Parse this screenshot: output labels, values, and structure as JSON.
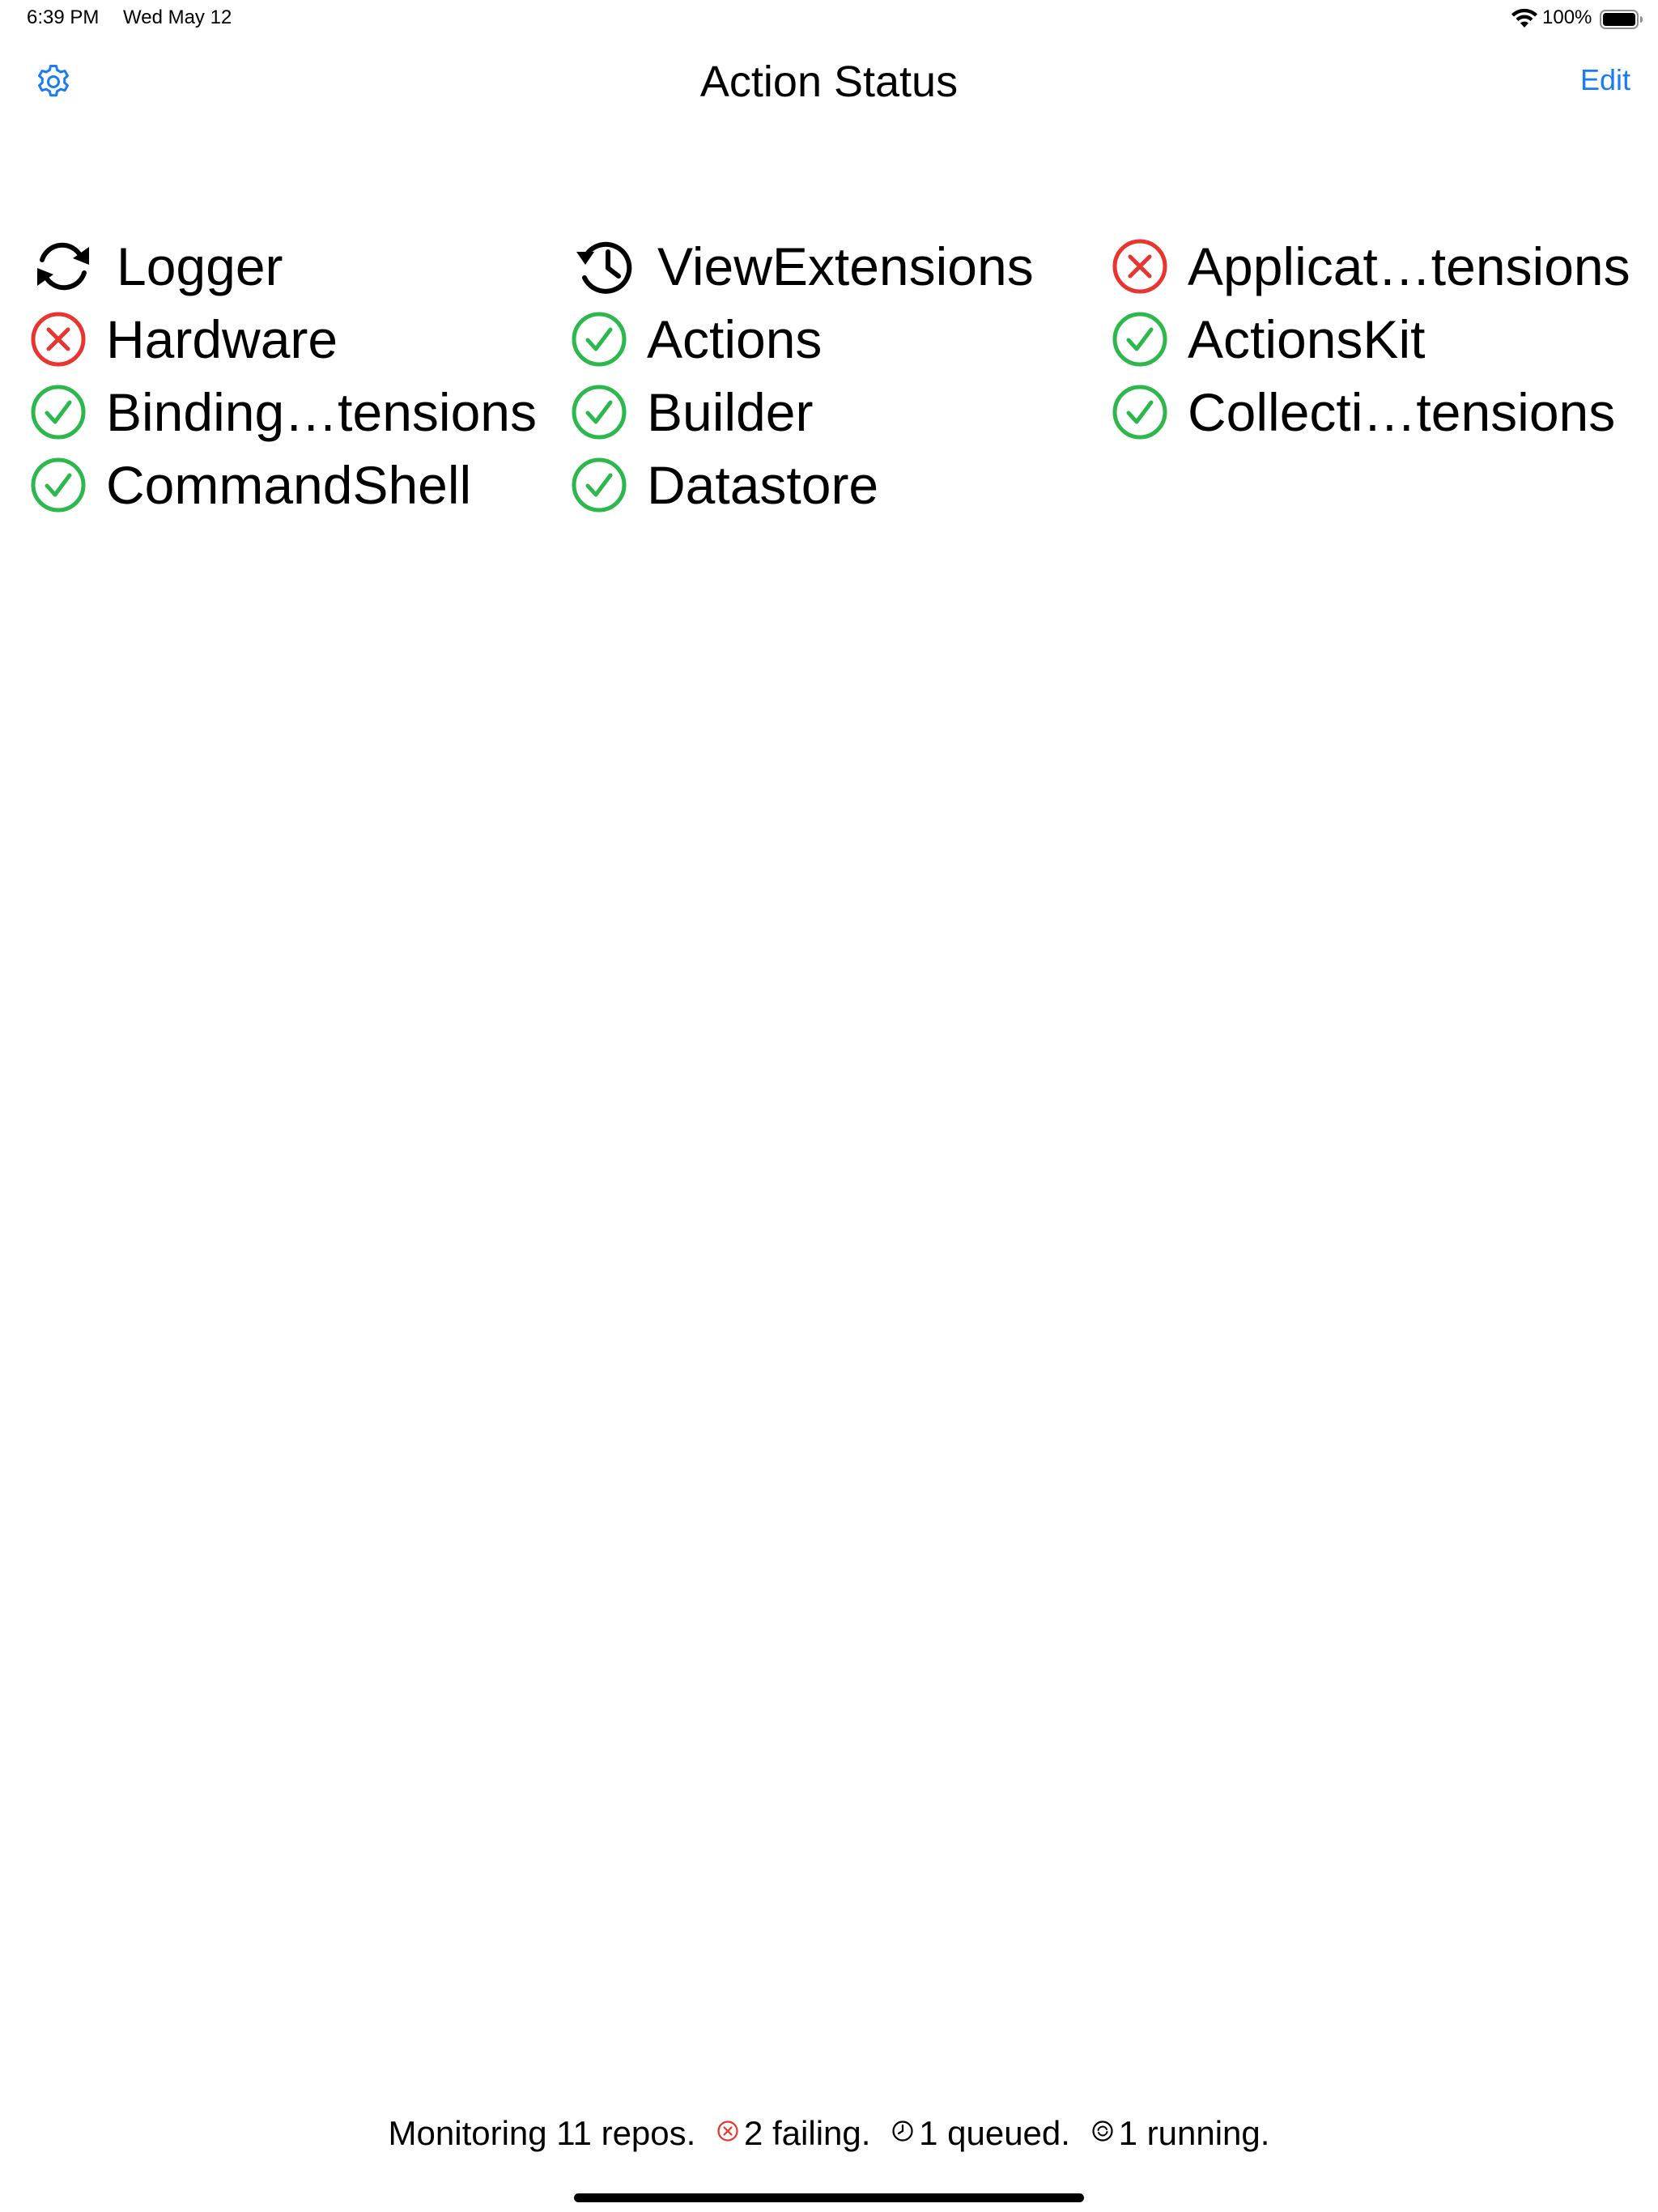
{
  "status_bar": {
    "time": "6:39 PM",
    "date": "Wed May 12",
    "battery_percent": "100%",
    "icons": [
      "wifi-icon",
      "battery-icon"
    ]
  },
  "nav": {
    "title": "Action Status",
    "edit_label": "Edit",
    "settings_icon": "gear-icon",
    "accent_color": "#1a7cf5"
  },
  "repos": [
    {
      "name": "Logger",
      "status": "running",
      "icon": "sync-icon"
    },
    {
      "name": "ViewExtensions",
      "status": "queued",
      "icon": "clock-history-icon"
    },
    {
      "name": "Applicat…tensions",
      "status": "failing",
      "icon": "x-circle-icon"
    },
    {
      "name": "Hardware",
      "status": "failing",
      "icon": "x-circle-icon"
    },
    {
      "name": "Actions",
      "status": "passing",
      "icon": "check-circle-icon"
    },
    {
      "name": "ActionsKit",
      "status": "passing",
      "icon": "check-circle-icon"
    },
    {
      "name": "Binding…tensions",
      "status": "passing",
      "icon": "check-circle-icon"
    },
    {
      "name": "Builder",
      "status": "passing",
      "icon": "check-circle-icon"
    },
    {
      "name": "Collecti…tensions",
      "status": "passing",
      "icon": "check-circle-icon"
    },
    {
      "name": "CommandShell",
      "status": "passing",
      "icon": "check-circle-icon"
    },
    {
      "name": "Datastore",
      "status": "passing",
      "icon": "check-circle-icon"
    }
  ],
  "status_colors": {
    "failing": "#e8352d",
    "passing": "#2db84d",
    "neutral": "#000000"
  },
  "footer": {
    "monitoring": "Monitoring 11 repos.",
    "failing": "2 failing.",
    "queued": "1 queued.",
    "running": "1 running."
  }
}
